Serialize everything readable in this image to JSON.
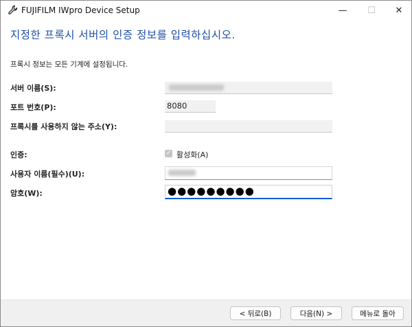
{
  "window": {
    "title": "FUJIFILM IWpro Device Setup",
    "minimize_glyph": "—",
    "maximize_glyph": "☐",
    "close_glyph": "✕"
  },
  "page": {
    "heading": "지정한 프록시 서버의 인증 정보를 입력하십시오.",
    "description": "프록시 정보는 모든 기계에 설정됩니다."
  },
  "form": {
    "server_name_label": "서버 이름(S):",
    "port_label": "포트 번호(P):",
    "port_value": "8080",
    "no_proxy_label": "프록시를 사용하지 않는 주소(Y):",
    "auth_label": "인증:",
    "auth_checkbox_label": "활성화(A)",
    "auth_checked": true,
    "username_label": "사용자 이름(필수)(U):",
    "password_label": "암호(W):",
    "password_mask": "●●●●●●●●●"
  },
  "buttons": {
    "back": "< 뒤로(B)",
    "next": "다음(N) >",
    "menu": "메뉴로 돌아"
  },
  "colors": {
    "heading": "#1d4fa8",
    "focus_underline": "#0a5ad4",
    "footer_bg": "#f0f0f0"
  }
}
